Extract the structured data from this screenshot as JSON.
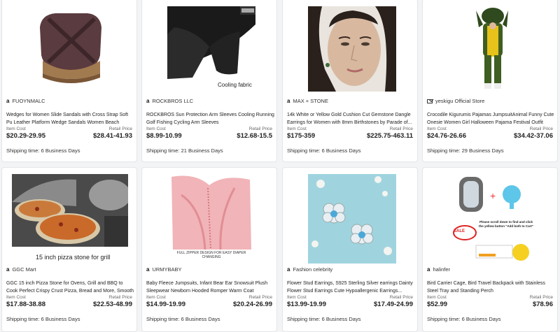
{
  "products": [
    {
      "store": "FUOYNMALC",
      "store_icon": "amazon-icon",
      "title": "Wedges for Women Slide Sandals with Cross Strap Soft Pu Leather Platform Wedge Sandals Women Beach Slide...",
      "cost_label": "Item Cost",
      "cost": "$20.29-29.95",
      "retail_label": "Retail Price",
      "retail": "$28.41-41.93",
      "shipping": "Shipping time: 6 Business Days"
    },
    {
      "store": "ROCKBROS LLC",
      "store_icon": "amazon-icon",
      "title": "ROCKBROS Sun Protection Arm Sleeves Cooling Running Golf Fishing Cycling Arm Sleeves",
      "cost_label": "Item Cost",
      "cost": "$8.99-10.99",
      "retail_label": "Retail Price",
      "retail": "$12.68-15.5",
      "shipping": "Shipping time: 21 Business Days",
      "image_caption": "Cooling fabric"
    },
    {
      "store": "MAX + STONE",
      "store_icon": "amazon-icon",
      "title": "14k White or Yellow Gold Cushion Cut Gemstone Dangle Earrings for Women with 8mm Birthstones by Parade of...",
      "cost_label": "Item Cost",
      "cost": "$175-359",
      "retail_label": "Retail Price",
      "retail": "$225.75-463.11",
      "shipping": "Shipping time: 6 Business Days"
    },
    {
      "store": "yeskigu Official Store",
      "store_icon": "mail-icon",
      "title": "Crocodile Kigurumis Pajamas JumpsuitAnimal Funny Cute Onesie Women Girl Halloween Pajama Festival Outfit Part...",
      "cost_label": "Item Cost",
      "cost": "$24.76-26.66",
      "retail_label": "Retail Price",
      "retail": "$34.42-37.06",
      "shipping": "Shipping time: 29 Business Days"
    },
    {
      "store": "GGC Mart",
      "store_icon": "amazon-icon",
      "title": "GGC 15 inch Pizza Stone for Ovens, Grill and BBQ to Cook Perfect Crispy Crust Pizza, Bread and More, Smooth Rou...",
      "cost_label": "Item Cost",
      "cost": "$17.88-38.88",
      "retail_label": "Retail Price",
      "retail": "$22.53-48.99",
      "shipping": "Shipping time: 6 Business Days",
      "image_caption": "15 inch pizza stone for grill"
    },
    {
      "store": "URMYBABY",
      "store_icon": "amazon-icon",
      "title": "Baby Fleece Jumpsuits, Infant Bear Ear Snowsuit Plush Sleepwear Newborn Hooded Romper Warm Coat",
      "cost_label": "Item Cost",
      "cost": "$14.99-19.99",
      "retail_label": "Retail Price",
      "retail": "$20.24-26.99",
      "shipping": "Shipping time: 6 Business Days",
      "image_caption": "FULL ZIPPER DESIGN FOR EASY DIAPER CHANGING"
    },
    {
      "store": "Fashion celebrity",
      "store_icon": "amazon-icon",
      "title": "Flower Stud Earrings, S925 Sterling Silver earrings Dainty Flower Stud Earrings Cute Hypoallergenic Earrings...",
      "cost_label": "Item Cost",
      "cost": "$13.99-19.99",
      "retail_label": "Retail Price",
      "retail": "$17.49-24.99",
      "shipping": "Shipping time: 6 Business Days"
    },
    {
      "store": "halinfer",
      "store_icon": "amazon-icon",
      "title": "Bird Carrier Cage, Bird Travel Backpack with Stainless Steel Tray and Standing Perch",
      "cost_label": "Item Cost",
      "cost": "$52.99",
      "retail_label": "Retail Price",
      "retail": "$78.96",
      "shipping": "Shipping time: 6 Business Days",
      "image_caption": "Please scroll down to find and click the yellow button \"Add both to Cart\"",
      "image_badge": "SALE"
    }
  ]
}
